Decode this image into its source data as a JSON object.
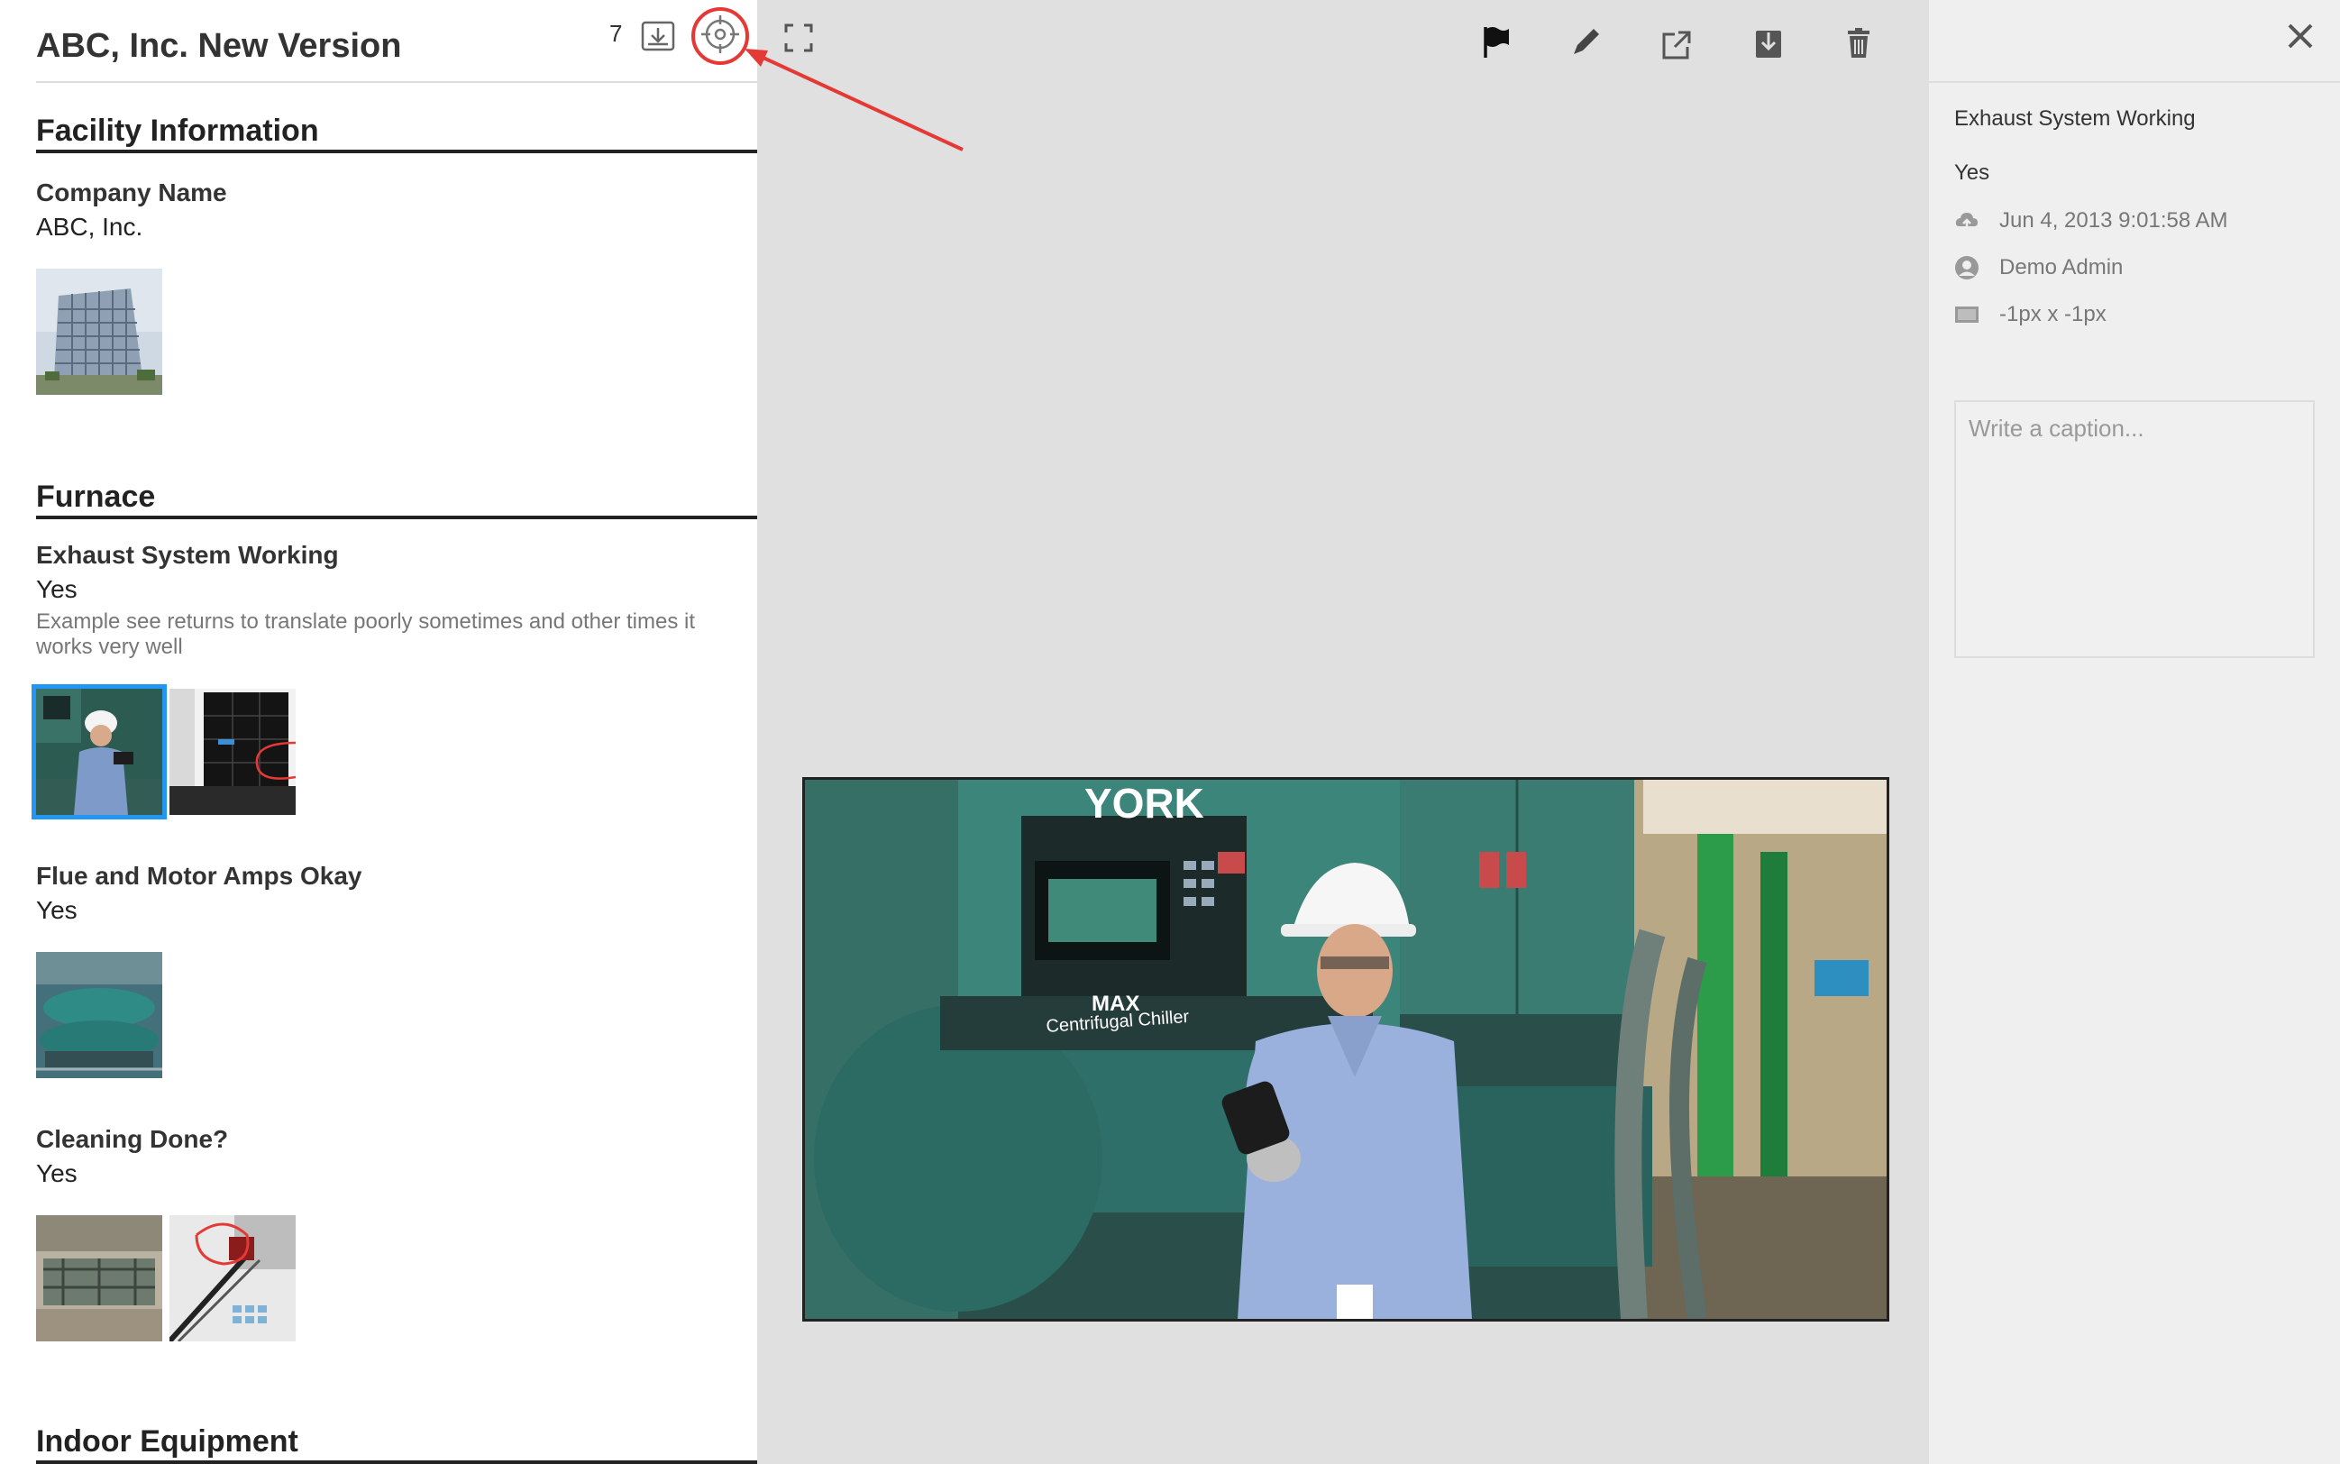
{
  "header": {
    "title": "ABC, Inc. New Version",
    "count": "7"
  },
  "sections": [
    {
      "heading": "Facility Information",
      "fields": [
        {
          "label": "Company Name",
          "value": "ABC, Inc."
        }
      ]
    },
    {
      "heading": "Furnace",
      "fields": [
        {
          "label": "Exhaust System Working",
          "value": "Yes",
          "note": "Example see returns to translate poorly sometimes and other times it works very well"
        },
        {
          "label": "Flue and Motor Amps Okay",
          "value": "Yes"
        },
        {
          "label": "Cleaning Done?",
          "value": "Yes"
        }
      ]
    },
    {
      "heading": "Indoor Equipment"
    }
  ],
  "toolbar": {
    "icons": [
      "fullscreen-icon",
      "flag-icon",
      "pencil-icon",
      "open-external-icon",
      "download-icon",
      "trash-icon"
    ]
  },
  "photo": {
    "brand_text": "YORK",
    "model_text": "MAX",
    "model_sub": "Centrifugal Chiller"
  },
  "details": {
    "question": "Exhaust System Working",
    "answer": "Yes",
    "timestamp": "Jun 4, 2013 9:01:58 AM",
    "user": "Demo Admin",
    "dimensions": "-1px x -1px",
    "caption_placeholder": "Write a caption..."
  },
  "colors": {
    "accent": "#2196f3",
    "annotation": "#e53935",
    "viewer_bg": "#e0e0e0",
    "details_bg": "#efefef"
  }
}
